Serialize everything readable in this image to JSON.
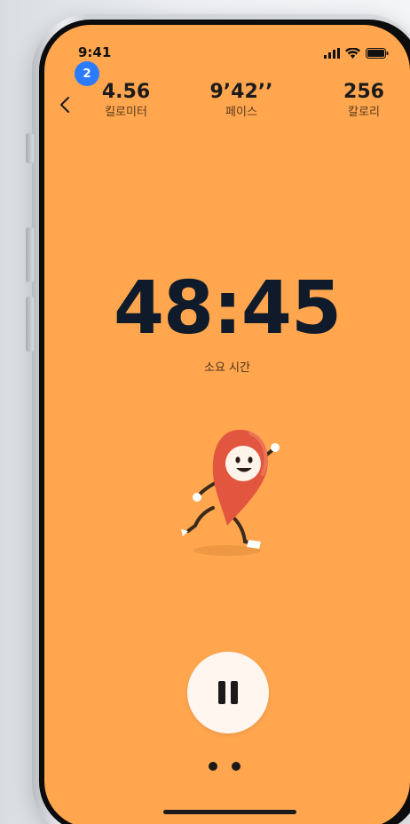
{
  "status_bar": {
    "time": "9:41",
    "icons": [
      "signal-icon",
      "wifi-icon",
      "battery-icon"
    ]
  },
  "notification_badge": "2",
  "stats": {
    "distance": {
      "value": "4.56",
      "label": "킬로미터"
    },
    "pace": {
      "value": "9’42’’",
      "label": "페이스"
    },
    "calories": {
      "value": "256",
      "label": "칼로리"
    }
  },
  "timer": {
    "value": "48:45",
    "label": "소요 시간"
  },
  "controls": {
    "pause_icon": "pause-icon",
    "back_icon": "chevron-left-icon"
  },
  "pager": {
    "count": 2
  },
  "colors": {
    "background": "#ffa64f",
    "timer_text": "#0f1a2a",
    "badge": "#2b7bff",
    "mascot": "#e2553f"
  }
}
